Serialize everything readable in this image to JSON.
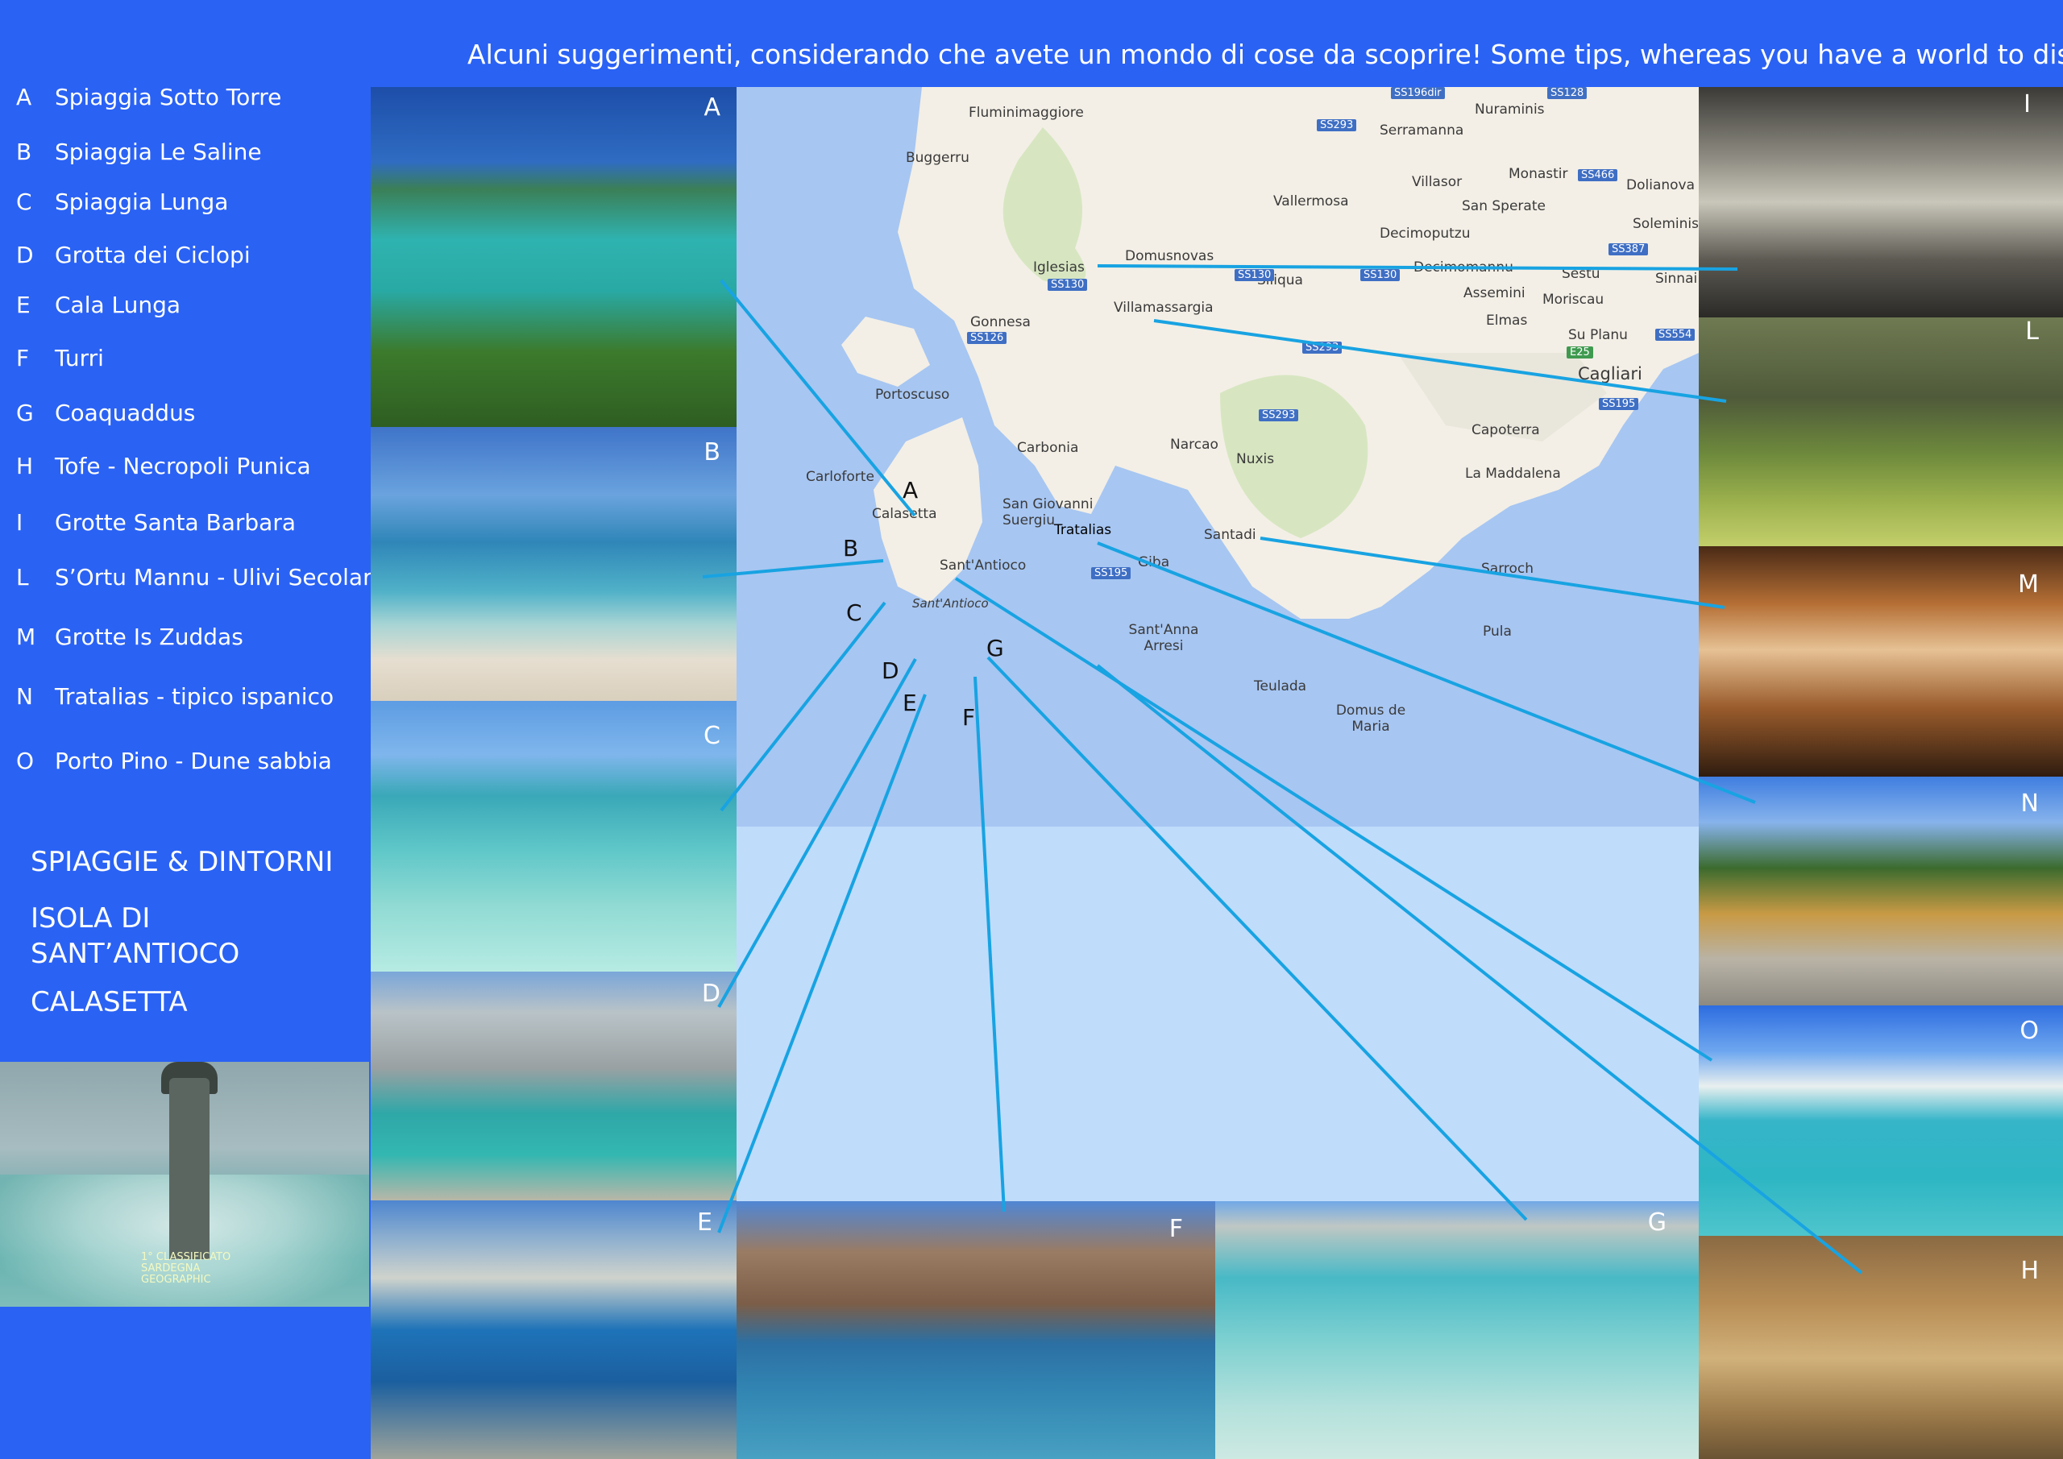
{
  "header": {
    "text": "Alcuni suggerimenti, considerando che avete un mondo di cose da scoprire!  Some tips, whereas you have a world to discover"
  },
  "legend": [
    {
      "k": "A",
      "v": "Spiaggia Sotto Torre"
    },
    {
      "k": "B",
      "v": "Spiaggia Le Saline"
    },
    {
      "k": "C",
      "v": "Spiaggia Lunga"
    },
    {
      "k": "D",
      "v": "Grotta dei Ciclopi"
    },
    {
      "k": "E",
      "v": "Cala Lunga"
    },
    {
      "k": "F",
      "v": "Turri"
    },
    {
      "k": "G",
      "v": "Coaquaddus"
    },
    {
      "k": "H",
      "v": "Tofe - Necropoli Punica"
    },
    {
      "k": "I",
      "v": "Grotte Santa Barbara"
    },
    {
      "k": "L",
      "v": "S’Ortu Mannu - Ulivi Secolari"
    },
    {
      "k": "M",
      "v": "Grotte Is Zuddas"
    },
    {
      "k": "N",
      "v": "Tratalias - tipico ispanico"
    },
    {
      "k": "O",
      "v": "Porto Pino - Dune sabbia"
    }
  ],
  "sections": [
    "SPIAGGIE & DINTORNI",
    "ISOLA DI",
    "SANT’ANTIOCO",
    "CALASETTA"
  ],
  "lighthouse_logo": [
    "1° CLASSIFICATO",
    "SARDEGNA",
    "GEOGRAPHIC"
  ],
  "photo_labels": {
    "A": "A",
    "B": "B",
    "C": "C",
    "D": "D",
    "E": "E",
    "F": "F",
    "G": "G",
    "H": "H",
    "I": "I",
    "L": "L",
    "M": "M",
    "N": "N",
    "O": "O"
  },
  "map": {
    "places": [
      "Fluminimaggiore",
      "Buggerru",
      "Iglesias",
      "Gonnesa",
      "Portoscuso",
      "Carloforte",
      "Calasetta",
      "Carbonia",
      "San Giovanni Suergiu",
      "Sant'Antioco",
      "Sant'Antioco",
      "Tratalias",
      "Giba",
      "Narcao",
      "Nuxis",
      "Santadi",
      "Villamassargia",
      "Domusnovas",
      "Vallermosa",
      "Siliqua",
      "Serramanna",
      "Nuraminis",
      "Villasor",
      "Monastir",
      "Dolianova",
      "San Sperate",
      "Decimoputzu",
      "Decimomannu",
      "Soleminis",
      "Sestu",
      "Sinnai",
      "Assemini",
      "Elmas",
      "Moriscau",
      "Su Planu",
      "Cagliari",
      "Capoterra",
      "La Maddalena",
      "Sarroch",
      "Pula",
      "Teulada",
      "Domus de Maria",
      "Sant'Anna Arresi"
    ],
    "roads": [
      "SS196dir",
      "SS128",
      "SS293",
      "SS466",
      "SS387",
      "SS130",
      "SS130",
      "SS130",
      "SS126",
      "SS293",
      "E25",
      "SS554",
      "SS195",
      "SS293",
      "SS195"
    ],
    "letters": [
      "A",
      "B",
      "C",
      "D",
      "E",
      "G",
      "F"
    ]
  }
}
